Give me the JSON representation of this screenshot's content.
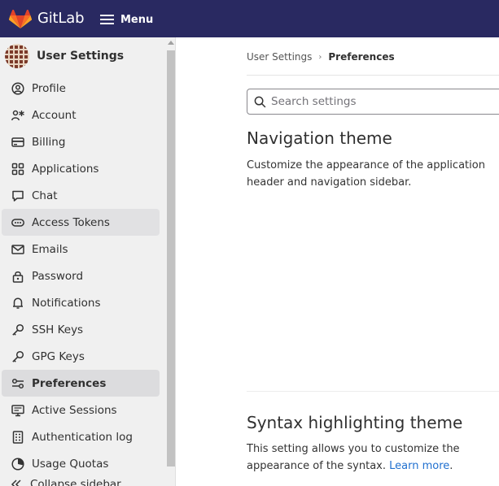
{
  "header": {
    "brand": "GitLab",
    "menu_label": "Menu",
    "bg_color": "#292961"
  },
  "sidebar": {
    "title": "User Settings",
    "items": [
      {
        "label": "Profile",
        "icon": "profile-icon"
      },
      {
        "label": "Account",
        "icon": "account-icon"
      },
      {
        "label": "Billing",
        "icon": "billing-icon"
      },
      {
        "label": "Applications",
        "icon": "applications-icon"
      },
      {
        "label": "Chat",
        "icon": "chat-icon"
      },
      {
        "label": "Access Tokens",
        "icon": "token-icon"
      },
      {
        "label": "Emails",
        "icon": "mail-icon"
      },
      {
        "label": "Password",
        "icon": "lock-icon"
      },
      {
        "label": "Notifications",
        "icon": "bell-icon"
      },
      {
        "label": "SSH Keys",
        "icon": "key-icon"
      },
      {
        "label": "GPG Keys",
        "icon": "key-icon"
      },
      {
        "label": "Preferences",
        "icon": "preferences-icon"
      },
      {
        "label": "Active Sessions",
        "icon": "monitor-icon"
      },
      {
        "label": "Authentication log",
        "icon": "log-icon"
      },
      {
        "label": "Usage Quotas",
        "icon": "quota-icon"
      }
    ],
    "collapse_label": "Collapse sidebar"
  },
  "breadcrumb": {
    "parent": "User Settings",
    "current": "Preferences"
  },
  "search": {
    "placeholder": "Search settings"
  },
  "sections": {
    "navigation_theme": {
      "title": "Navigation theme",
      "description": "Customize the appearance of the application header and navigation sidebar."
    },
    "syntax_theme": {
      "title": "Syntax highlighting theme",
      "description": "This setting allows you to customize the appearance of the syntax.",
      "link_label": "Learn more",
      "link_suffix": "."
    }
  }
}
